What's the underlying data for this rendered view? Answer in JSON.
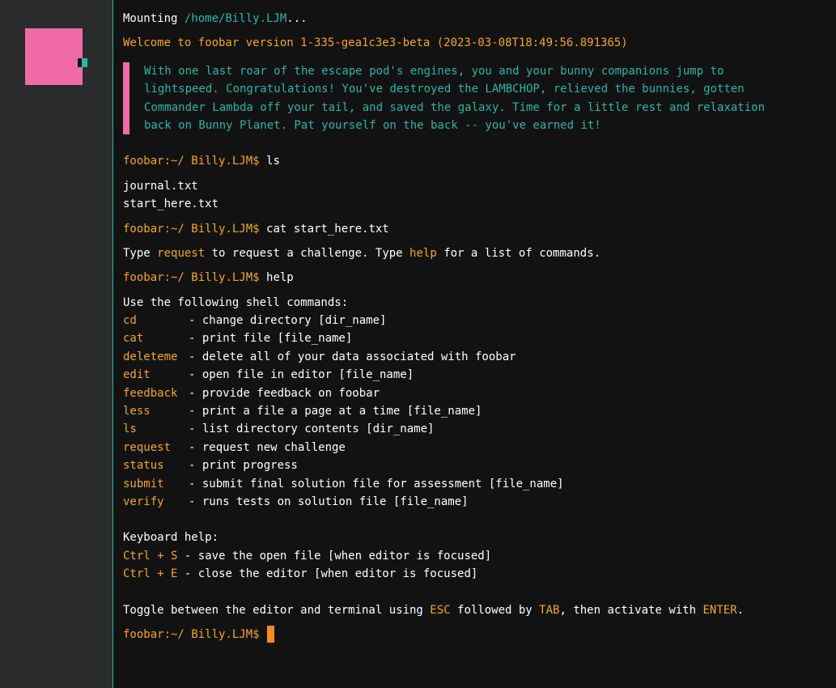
{
  "mount": {
    "label": "Mounting ",
    "path": "/home/Billy.LJM",
    "ellipsis": "..."
  },
  "welcome": "Welcome to foobar version 1-335-gea1c3e3-beta (2023-03-08T18:49:56.891365)",
  "story": [
    "With one last roar of the escape pod's engines, you and your bunny companions jump to",
    "lightspeed. Congratulations! You've destroyed the LAMBCHOP, relieved the bunnies, gotten",
    "Commander Lambda off your tail, and saved the galaxy. Time for a little rest and relaxation",
    "back on Bunny Planet. Pat yourself on the back -- you've earned it!"
  ],
  "prompt": "foobar:~/ Billy.LJM$",
  "commands_entered": {
    "first": "ls",
    "second": "cat start_here.txt",
    "third": "help"
  },
  "files": [
    "journal.txt",
    "start_here.txt"
  ],
  "start_here": {
    "p1": "Type ",
    "k1": "request",
    "p2": " to request a challenge. Type ",
    "k2": "help",
    "p3": " for a list of commands."
  },
  "help": {
    "heading": "Use the following shell commands:",
    "commands": [
      {
        "name": "cd",
        "desc": "- change directory [dir_name]"
      },
      {
        "name": "cat",
        "desc": "- print file [file_name]"
      },
      {
        "name": "deleteme",
        "desc": "- delete all of your data associated with foobar"
      },
      {
        "name": "edit",
        "desc": "- open file in editor [file_name]"
      },
      {
        "name": "feedback",
        "desc": "- provide feedback on foobar"
      },
      {
        "name": "less",
        "desc": "- print a file a page at a time [file_name]"
      },
      {
        "name": "ls",
        "desc": "- list directory contents [dir_name]"
      },
      {
        "name": "request",
        "desc": "- request new challenge"
      },
      {
        "name": "status",
        "desc": "- print progress"
      },
      {
        "name": "submit",
        "desc": "- submit final solution file for assessment [file_name]"
      },
      {
        "name": "verify",
        "desc": "- runs tests on solution file [file_name]"
      }
    ],
    "keyboard_heading": "Keyboard help:",
    "shortcuts": [
      {
        "keys": "Ctrl + S",
        "desc": " - save the open file [when editor is focused]"
      },
      {
        "keys": "Ctrl + E",
        "desc": " - close the editor [when editor is focused]"
      }
    ],
    "toggle": {
      "p1": "Toggle between the editor and terminal using ",
      "k1": "ESC",
      "p2": " followed by ",
      "k2": "TAB",
      "p3": ", then activate with ",
      "k3": "ENTER",
      "p4": "."
    }
  },
  "colors": {
    "background": "#121212",
    "sidebar": "#292b2c",
    "teal": "#2bb5a8",
    "orange": "#f5a623",
    "pink": "#f06ba6",
    "cursor": "#f58a1f"
  }
}
